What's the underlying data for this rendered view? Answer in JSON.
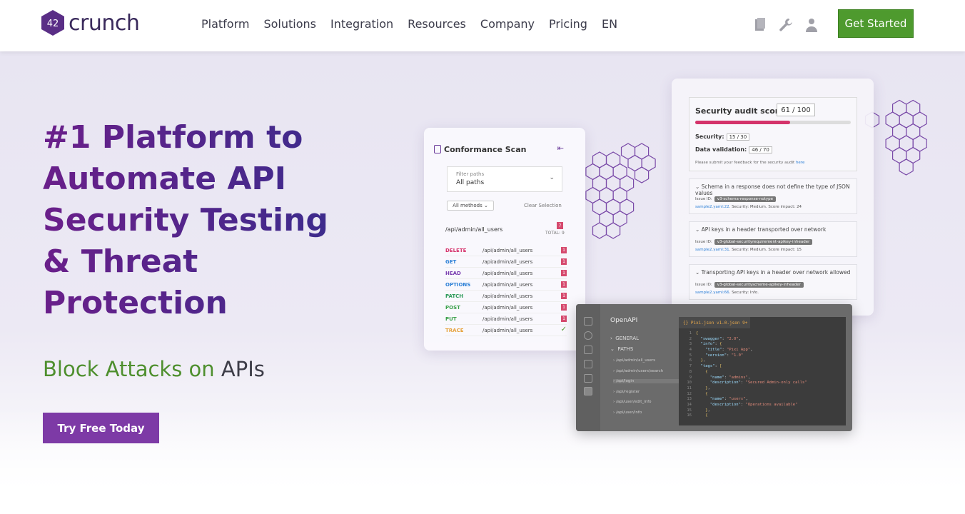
{
  "header": {
    "logo_text": "crunch",
    "logo_num": "42",
    "nav": [
      "Platform",
      "Solutions",
      "Integration",
      "Resources",
      "Company",
      "Pricing",
      "EN"
    ],
    "icons": [
      "document-icon",
      "wrench-icon",
      "user-icon"
    ],
    "cta": "Get Started",
    "cta_color": "#4e9a2e"
  },
  "hero": {
    "headline": "#1 Platform to Automate API Security Testing & Threat Protection",
    "sub_green": "Block Attacks on",
    "sub_dark": "APIs",
    "cta": "Try Free Today",
    "cta_color": "#7d3aa6"
  },
  "scan_card": {
    "title": "Conformance Scan",
    "filter_label": "Filter paths",
    "filter_value": "All paths",
    "methods": "All methods",
    "clear": "Clear Selection",
    "path": "/api/admin/all_users",
    "total_badge": "7",
    "total": "TOTAL: 9",
    "rows": [
      {
        "method": "DELETE",
        "color": "#d6336c",
        "path": "/api/admin/all_users",
        "badge": "1"
      },
      {
        "method": "GET",
        "color": "#2b7fd6",
        "path": "/api/admin/all_users",
        "badge": "1"
      },
      {
        "method": "HEAD",
        "color": "#7a3fb0",
        "path": "/api/admin/all_users",
        "badge": "1"
      },
      {
        "method": "OPTIONS",
        "color": "#2b7fd6",
        "path": "/api/admin/all_users",
        "badge": "1"
      },
      {
        "method": "PATCH",
        "color": "#2e9a5a",
        "path": "/api/admin/all_users",
        "badge": "1"
      },
      {
        "method": "POST",
        "color": "#3aa04a",
        "path": "/api/admin/all_users",
        "badge": "1"
      },
      {
        "method": "PUT",
        "color": "#3aa04a",
        "path": "/api/admin/all_users",
        "badge": "1"
      },
      {
        "method": "TRACE",
        "color": "#e6a23c",
        "path": "/api/admin/all_users",
        "badge": ""
      }
    ]
  },
  "audit_card": {
    "score_label": "Security audit score:",
    "score": "61 / 100",
    "score_fraction": 0.61,
    "security_label": "Security:",
    "security": "15 / 30",
    "validation_label": "Data validation:",
    "validation": "46 / 70",
    "feedback": "Please submit your feedback for the security audit",
    "feedback_link": "here",
    "issues": [
      {
        "title": "Schema in a response does not define the type of JSON values",
        "id": "v3-schema-response-notype",
        "file": "sample2.yaml:22",
        "info": ". Security: Medium. Score impact: 24"
      },
      {
        "title": "API keys in a header transported over network",
        "id": "v3-global-securityrequirement-apikey-inheader",
        "file": "sample2.yaml:31",
        "info": ". Security: Medium. Score impact: 15"
      },
      {
        "title": "Transporting API keys in a header over network allowed",
        "id": "v3-global-securityscheme-apikey-inheader",
        "file": "sample2.yaml:66",
        "info": ". Security: Info."
      }
    ],
    "issue_id_label": "Issue ID:"
  },
  "editor_card": {
    "title": "OpenAPI",
    "general": "GENERAL",
    "paths": "PATHS",
    "path_items": [
      "/api/admin/all_users",
      "/api/admin/users/search",
      "/api/login",
      "/api/register",
      "/api/user/edit_info",
      "/api/user/info"
    ],
    "tab": "{} Pixi.json  v1.0.json  9+",
    "code": [
      "{",
      "  \"swagger\": \"2.0\",",
      "  \"info\": {",
      "    \"title\": \"Pixi App\",",
      "    \"version\": \"1.0\"",
      "  },",
      "  \"tags\": [",
      "    {",
      "      \"name\": \"admins\",",
      "      \"description\": \"Secured Admin-only calls\"",
      "    },",
      "    {",
      "      \"name\": \"users\",",
      "      \"description\": \"Operations available\"",
      "    },",
      "    {"
    ]
  }
}
